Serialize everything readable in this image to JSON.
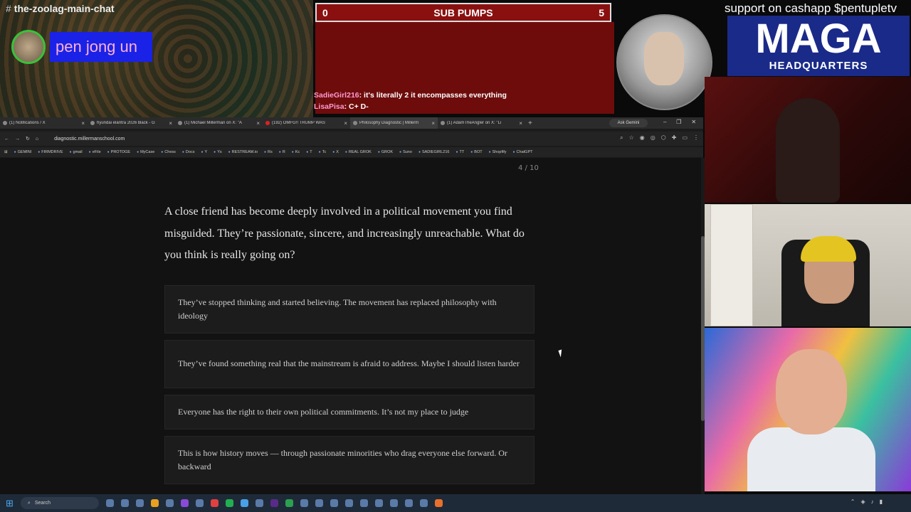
{
  "overlay": {
    "channel_hash": "#",
    "channel": "the-zoolag-main-chat",
    "username": "pen jong un",
    "score_left": "0",
    "score_title": "SUB PUMPS",
    "score_right": "5",
    "chat": [
      {
        "name": "SadieGirl216",
        "text": ": it's literally 2 it encompasses everything"
      },
      {
        "name": "LisaPisa",
        "text": ": C+ D-"
      }
    ],
    "support": "support on cashapp $pentupletv",
    "maga_big": "MAGA",
    "maga_small": "HEADQUARTERS"
  },
  "browser": {
    "tabs": [
      {
        "label": "(1) Notifications / X",
        "active": false
      },
      {
        "label": "hyundai elantra 2026 black - G",
        "active": false
      },
      {
        "label": "(1) Michael Millerman on X: \"A",
        "active": false
      },
      {
        "label": "(192) OMFG!! TRUMP WAS",
        "active": false
      },
      {
        "label": "Philosophy Diagnostic | Millerm",
        "active": true
      },
      {
        "label": "(1) AdamTheAngler on X: \"Li",
        "active": false
      }
    ],
    "new_tab": "+",
    "ask_gemini": "Ask Gemini",
    "url": "diagnostic.millermanschool.com",
    "bookmarks": [
      "GEMINI",
      "FIRMDRIVE",
      "gmail",
      "eFile",
      "PROTOGE",
      "MyCase",
      "Chess",
      "Docs",
      "Y",
      "Ys",
      "RESTREAM.io",
      "Rs",
      "R",
      "Kc",
      "T",
      "Tc",
      "X",
      "REAL GROK",
      "GROK",
      "Suno",
      "SADIEGIRL216",
      "TT",
      "BOT",
      "Shopfify",
      "ChatGPT"
    ]
  },
  "quiz": {
    "progress": "4 / 10",
    "question": "A close friend has become deeply involved in a political movement you find misguided. They’re passionate, sincere, and increasingly unreachable. What do you think is really going on?",
    "options": [
      "They’ve stopped thinking and started believing. The movement has replaced philosophy with ideology",
      "They’ve found something real that the mainstream is afraid to address. Maybe I should listen harder",
      "Everyone has the right to their own political commitments. It’s not my place to judge",
      "This is how history moves — through passionate minorities who drag everyone else forward. Or backward"
    ]
  },
  "taskbar": {
    "search": "Search"
  },
  "colors": {
    "scorebar": "#8a1010",
    "username_bg": "#1a22e8",
    "maga_bg": "#1a2a88"
  }
}
